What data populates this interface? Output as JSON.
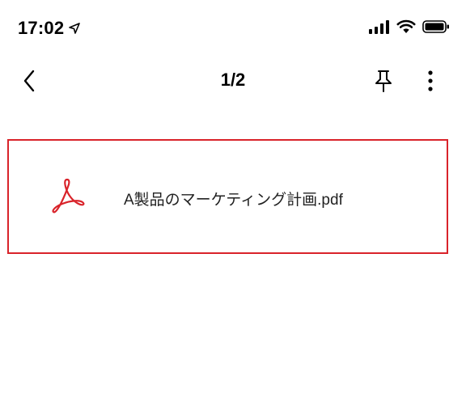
{
  "status_bar": {
    "time": "17:02",
    "icons": [
      "location-arrow-icon",
      "signal-icon",
      "wifi-icon",
      "battery-icon"
    ]
  },
  "nav": {
    "title": "1/2",
    "icons": [
      "chevron-left-icon",
      "pin-icon",
      "more-vertical-icon"
    ]
  },
  "file": {
    "name": "A製品のマーケティング計画.pdf",
    "icon": "pdf-icon"
  },
  "colors": {
    "accent": "#d9232a",
    "background": "#ffffff",
    "text": "#000000"
  }
}
